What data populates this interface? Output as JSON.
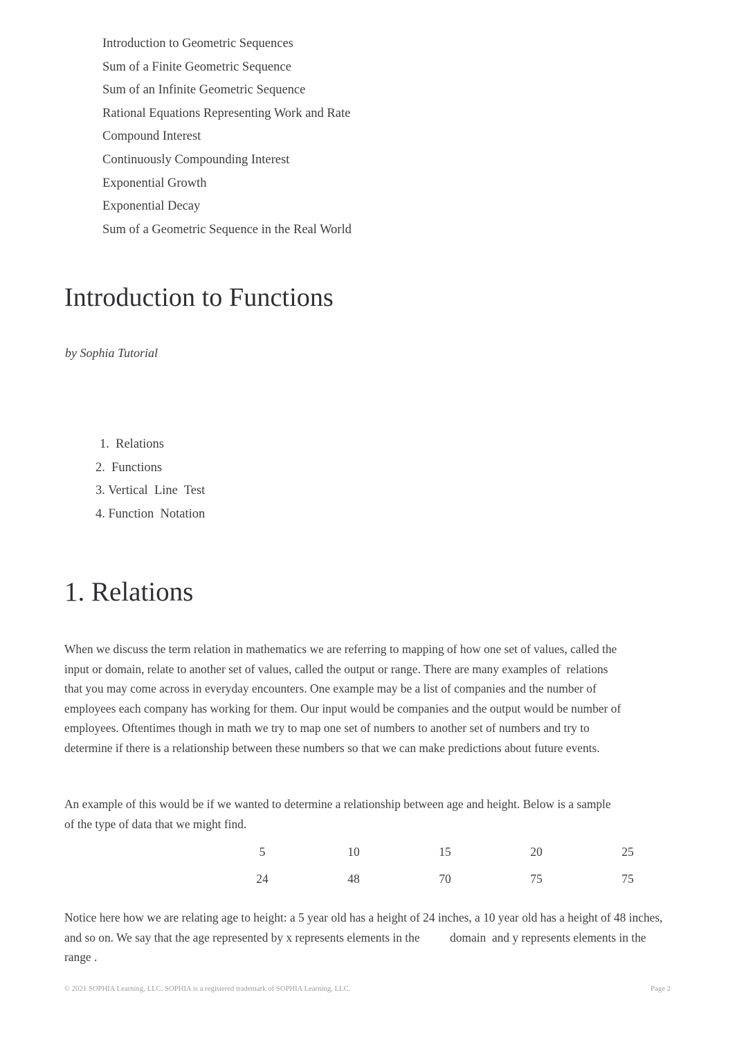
{
  "continuation_list": {
    "items": [
      "Introduction to Geometric Sequences",
      "Sum of a Finite Geometric Sequence",
      "Sum of an Infinite Geometric Sequence",
      "Rational Equations Representing Work and Rate",
      "Compound Interest",
      "Continuously Compounding Interest",
      "Exponential Growth",
      "Exponential Decay",
      "Sum of a Geometric Sequence in the Real World"
    ]
  },
  "title_block": {
    "title": "Introduction to Functions",
    "byline": "by Sophia Tutorial"
  },
  "outline": {
    "items": [
      "1.  Relations",
      "2.  Functions",
      "3. Vertical  Line  Test",
      "4. Function  Notation"
    ]
  },
  "section": {
    "heading": "1. Relations",
    "paragraph_1": "When we discuss the term relation in mathematics we are referring to mapping of how one set of values, called the input or domain, relate to another set of values, called the output or range. There are many examples of  relations  that you may come across in everyday encounters. One example may be a list of companies and the number of employees each company has working for them. Our input would be companies and the output would be number of employees. Oftentimes though in math we try to map one set of numbers to another set of numbers and try to determine if there is a relationship between these numbers so that we can make predictions about future events.",
    "paragraph_2": "An example of this would be if we wanted to determine a relationship between age and height. Below is a sample of the type of data that we might find.",
    "paragraph_3": "Notice here how we are relating age to height: a 5 year old has a height of 24 inches, a 10 year old has a height of 48 inches, and so on. We say that the age represented by x represents elements in the          domain  and y represents elements in the     range ."
  },
  "data_table": {
    "rows": [
      {
        "label": "",
        "values": [
          "5",
          "10",
          "15",
          "20",
          "25"
        ]
      },
      {
        "label": "",
        "values": [
          "24",
          "48",
          "70",
          "75",
          "75"
        ]
      }
    ]
  },
  "footer": {
    "copyright": "© 2021 SOPHIA Learning, LLC. SOPHIA is a registered trademark of SOPHIA Learning, LLC.",
    "page_label": "Page 2"
  },
  "colors": {
    "text": "#3c3c3e",
    "heading": "#2f2f33",
    "footer": "#9a9a9e",
    "background": "#ffffff"
  }
}
